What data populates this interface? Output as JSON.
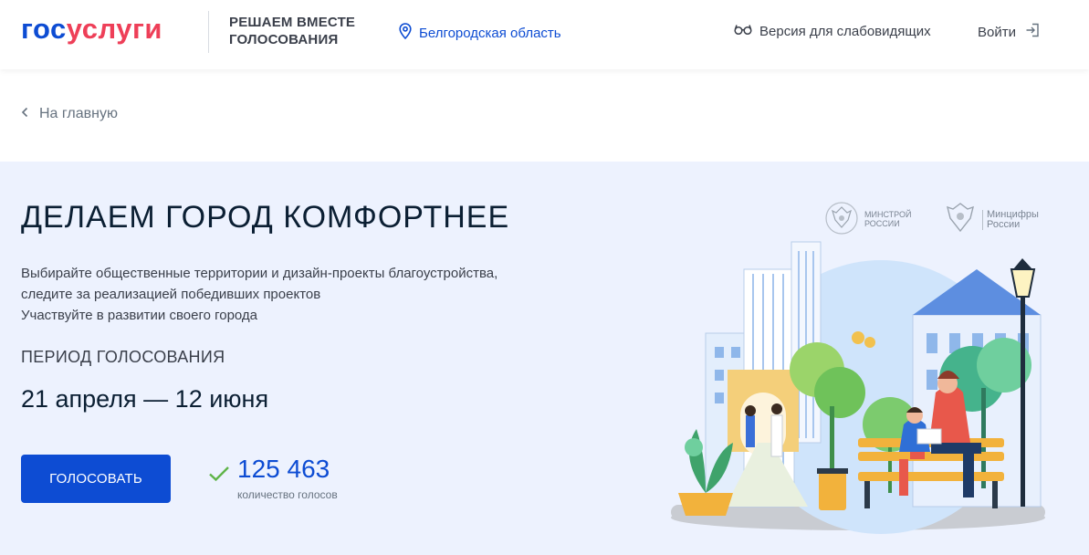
{
  "header": {
    "logo_left": "гос",
    "logo_right": "услуги",
    "project_title_line1": "РЕШАЕМ ВМЕСТЕ",
    "project_title_line2": "ГОЛОСОВАНИЯ",
    "region": "Белгородская область",
    "accessibility": "Версия для слабовидящих",
    "login": "Войти"
  },
  "breadcrumb": {
    "back": "На главную"
  },
  "hero": {
    "title": "ДЕЛАЕМ ГОРОД КОМФОРТНЕЕ",
    "desc_line1": "Выбирайте общественные территории и дизайн-проекты благоустройства,",
    "desc_line2": "следите за реализацией победивших проектов",
    "desc_line3": "Участвуйте в развитии своего города",
    "period_label": "ПЕРИОД ГОЛОСОВАНИЯ",
    "period_dates": "21 апреля — 12 июня",
    "vote_button": "ГОЛОСОВАТЬ",
    "vote_count": "125 463",
    "vote_count_label": "количество голосов"
  },
  "partners": {
    "minstroy_line1": "МИНСТРОЙ",
    "minstroy_line2": "РОССИИ",
    "mintsifry_line1": "Минцифры",
    "mintsifry_line2": "России"
  },
  "colors": {
    "brand_blue": "#0d4cd3",
    "brand_red": "#ee3f58",
    "hero_bg": "#edf2fe",
    "check_green": "#5fb448"
  }
}
